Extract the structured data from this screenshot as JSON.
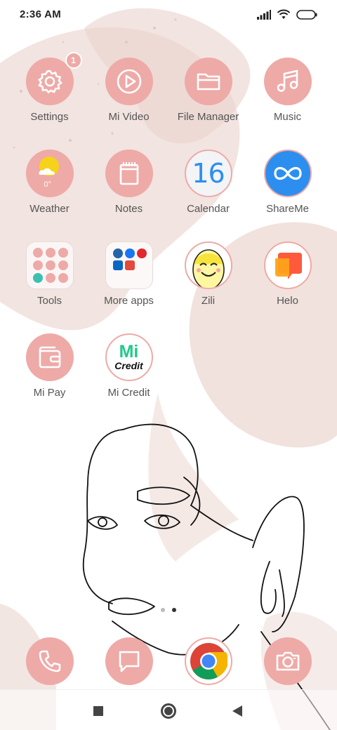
{
  "status_bar": {
    "time": "2:36 AM",
    "icons": [
      "signal-icon",
      "wifi-icon",
      "battery-icon"
    ]
  },
  "apps": [
    {
      "label": "Settings",
      "icon": "gear-icon",
      "badge": "1"
    },
    {
      "label": "Mi Video",
      "icon": "play-icon"
    },
    {
      "label": "File Manager",
      "icon": "folder-icon"
    },
    {
      "label": "Music",
      "icon": "music-note-icon"
    },
    {
      "label": "Weather",
      "icon": "weather-icon",
      "temperature": "0°"
    },
    {
      "label": "Notes",
      "icon": "notepad-icon"
    },
    {
      "label": "Calendar",
      "icon": "calendar-icon",
      "date": "16"
    },
    {
      "label": "ShareMe",
      "icon": "shareme-icon"
    },
    {
      "label": "Tools",
      "icon": "tools-folder-icon"
    },
    {
      "label": "More apps",
      "icon": "more-apps-folder-icon"
    },
    {
      "label": "Zili",
      "icon": "zili-icon"
    },
    {
      "label": "Helo",
      "icon": "helo-icon"
    },
    {
      "label": "Mi Pay",
      "icon": "wallet-icon"
    },
    {
      "label": "Mi Credit",
      "icon": "mi-credit-icon",
      "logo_top": "Mi",
      "logo_bottom": "Credit"
    }
  ],
  "page_indicator": {
    "pages": 2,
    "active": 2
  },
  "dock": [
    {
      "icon": "phone-icon"
    },
    {
      "icon": "message-icon"
    },
    {
      "icon": "chrome-icon"
    },
    {
      "icon": "camera-icon"
    }
  ],
  "nav_bar": [
    "recents-button",
    "home-button",
    "back-button"
  ],
  "colors": {
    "icon_pink": "#eeaaa7",
    "wallpaper_beige": "#eddbd5",
    "shareme_blue": "#2c8ff0"
  }
}
